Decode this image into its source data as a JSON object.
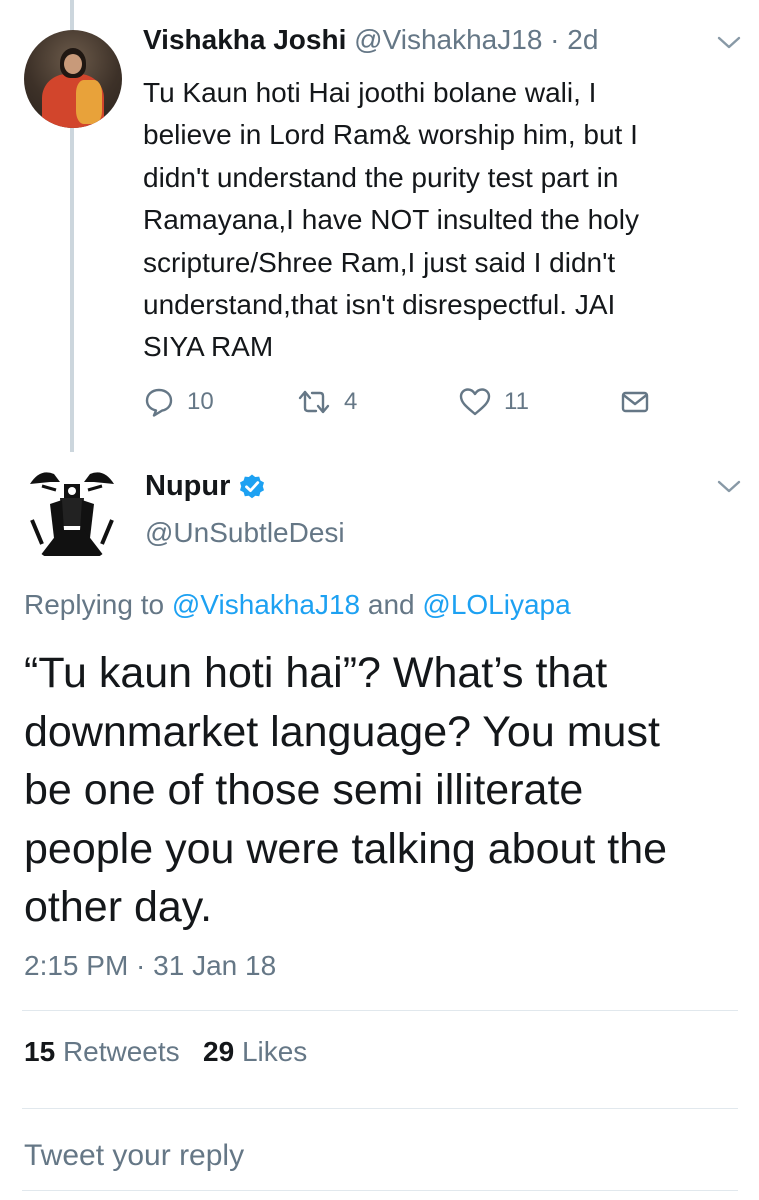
{
  "parent_tweet": {
    "display_name": "Vishakha Joshi",
    "handle": "@VishakhaJ18",
    "separator": "·",
    "age": "2d",
    "lines": [
      "Tu Kaun hoti Hai joothi bolane wali, I",
      "believe in Lord Ram& worship him, but I",
      "didn't understand the purity test part in",
      "Ramayana,I have NOT insulted the holy",
      "scripture/Shree Ram,I just said I didn't",
      "understand,that isn't disrespectful. JAI",
      "SIYA RAM"
    ],
    "actions": {
      "reply_count": "10",
      "retweet_count": "4",
      "like_count": "11"
    }
  },
  "main_tweet": {
    "display_name": "Nupur",
    "verified": true,
    "handle": "@UnSubtleDesi",
    "replying_label": "Replying to",
    "mention_1": "@VishakhaJ18",
    "conjunction": "and",
    "mention_2": "@LOLiyapa",
    "lines": [
      "“Tu kaun hoti hai”? What’s that",
      "downmarket language? You must",
      "be one of those semi illiterate",
      "people you were talking about the",
      "other day."
    ],
    "timestamp": "2:15 PM · 31 Jan 18"
  },
  "stats": {
    "retweets_count": "15",
    "retweets_label": "Retweets",
    "likes_count": "29",
    "likes_label": "Likes"
  },
  "reply_box": {
    "placeholder": "Tweet your reply"
  },
  "colors": {
    "text": "#14171a",
    "muted": "#657786",
    "link": "#1da1f2",
    "verified": "#1da1f2",
    "divider": "#e1e8ed",
    "thread_line": "#ccd6dd"
  },
  "icons": {
    "reply": "speech-bubble-icon",
    "retweet": "retweet-icon",
    "like": "heart-icon",
    "dm": "envelope-icon",
    "menu": "chevron-down-icon",
    "verified": "verified-badge-icon"
  }
}
